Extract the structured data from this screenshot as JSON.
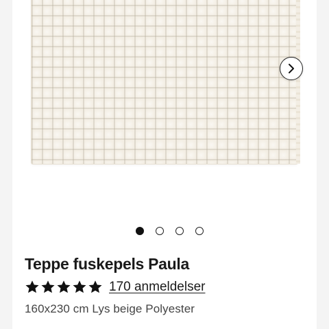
{
  "product": {
    "title": "Teppe fuskepels Paula",
    "rating": {
      "stars_filled": 5,
      "stars_total": 5,
      "reviews_label": "170 anmeldelser"
    },
    "description": "160x230 cm Lys beige Polyester",
    "image": {
      "subject": "light beige faux fur rug",
      "color": "#f3eee4"
    }
  },
  "carousel": {
    "slide_count": 4,
    "active_index": 0,
    "next_icon": "chevron-right-icon"
  }
}
